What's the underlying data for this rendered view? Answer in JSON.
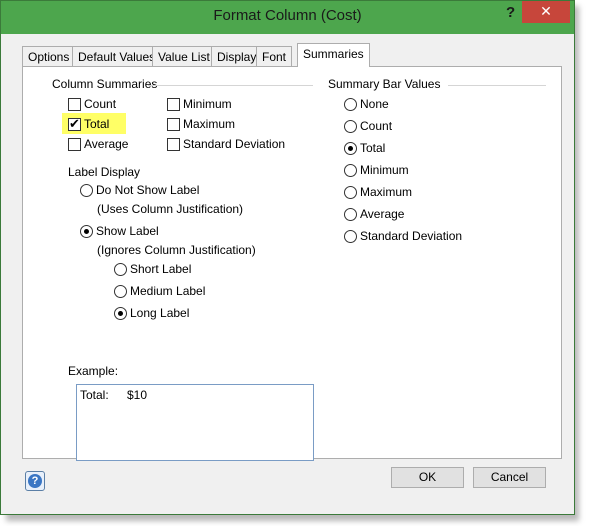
{
  "window": {
    "title": "Format Column (Cost)",
    "help_glyph": "?",
    "close_glyph": "✕"
  },
  "tabs": [
    {
      "label": "Options"
    },
    {
      "label": "Default Values"
    },
    {
      "label": "Value List"
    },
    {
      "label": "Display"
    },
    {
      "label": "Font"
    },
    {
      "label": "Summaries",
      "selected": true
    }
  ],
  "column_summaries": {
    "heading": "Column Summaries",
    "count": {
      "label": "Count",
      "checked": false
    },
    "total": {
      "label": "Total",
      "checked": true
    },
    "average": {
      "label": "Average",
      "checked": false
    },
    "minimum": {
      "label": "Minimum",
      "checked": false
    },
    "maximum": {
      "label": "Maximum",
      "checked": false
    },
    "std_dev": {
      "label": "Standard Deviation",
      "checked": false
    }
  },
  "label_display": {
    "heading": "Label Display",
    "do_not_show": {
      "label": "Do Not Show Label",
      "note": "(Uses Column Justification)",
      "selected": false
    },
    "show": {
      "label": "Show Label",
      "note": "(Ignores Column Justification)",
      "selected": true
    },
    "short": {
      "label": "Short Label",
      "selected": false
    },
    "medium": {
      "label": "Medium Label",
      "selected": false
    },
    "long": {
      "label": "Long Label",
      "selected": true
    }
  },
  "example": {
    "heading": "Example:",
    "label": "Total:",
    "value": "$10"
  },
  "summary_bar": {
    "heading": "Summary Bar Values",
    "options": [
      {
        "label": "None",
        "selected": false
      },
      {
        "label": "Count",
        "selected": false
      },
      {
        "label": "Total",
        "selected": true
      },
      {
        "label": "Minimum",
        "selected": false
      },
      {
        "label": "Maximum",
        "selected": false
      },
      {
        "label": "Average",
        "selected": false
      },
      {
        "label": "Standard Deviation",
        "selected": false
      }
    ]
  },
  "buttons": {
    "ok": "OK",
    "cancel": "Cancel",
    "help": "?"
  },
  "colors": {
    "titlebar": "#4da64d",
    "close": "#c7463b",
    "highlight": "#ffff66"
  }
}
